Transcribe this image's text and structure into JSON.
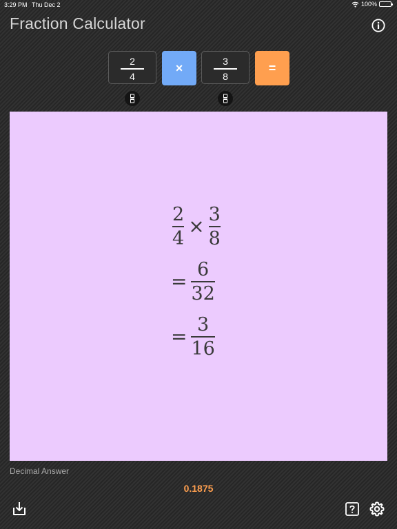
{
  "status_bar": {
    "time": "3:29 PM",
    "date": "Thu Dec 2",
    "battery": "100%"
  },
  "header": {
    "title": "Fraction Calculator"
  },
  "input": {
    "fraction1": {
      "numerator": "2",
      "denominator": "4"
    },
    "operator_label": "×",
    "fraction2": {
      "numerator": "3",
      "denominator": "8"
    },
    "equals_label": "="
  },
  "result": {
    "expression": {
      "a_num": "2",
      "a_den": "4",
      "op": "×",
      "b_num": "3",
      "b_den": "8"
    },
    "steps": [
      {
        "eq": "=",
        "num": "6",
        "den": "32"
      },
      {
        "eq": "=",
        "num": "3",
        "den": "16"
      }
    ]
  },
  "decimal": {
    "label": "Decimal Answer",
    "value": "0.1875"
  },
  "colors": {
    "operator": "#72aaf7",
    "equals": "#ff9f4f",
    "panel": "#eccbfe",
    "decimal": "#ff9f4f"
  }
}
